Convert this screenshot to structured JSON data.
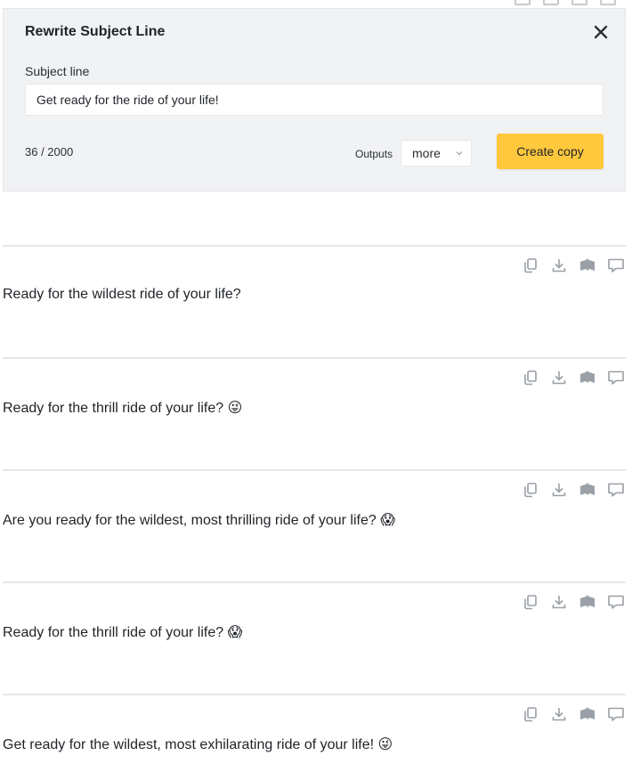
{
  "panel": {
    "title": "Rewrite Subject Line",
    "field_label": "Subject line",
    "subject_value": "Get ready for the ride of your life!",
    "counter": "36 / 2000",
    "outputs_label": "Outputs",
    "outputs_selected": "more",
    "create_button": "Create copy",
    "accent_color": "#ffc83d"
  },
  "results": [
    {
      "text": "Ready for the wildest ride of your life?",
      "emoji": ""
    },
    {
      "text": "Ready for the thrill ride of your life?",
      "emoji": "😜"
    },
    {
      "text": "Are you ready for the wildest, most thrilling ride of your life?",
      "emoji": "😱"
    },
    {
      "text": "Ready for the thrill ride of your life?",
      "emoji": "😱"
    },
    {
      "text": "Get ready for the wildest, most exhilarating ride of your life!",
      "emoji": "😜"
    }
  ],
  "result_actions": [
    "copy-icon",
    "download-icon",
    "save-icon",
    "comment-icon"
  ]
}
